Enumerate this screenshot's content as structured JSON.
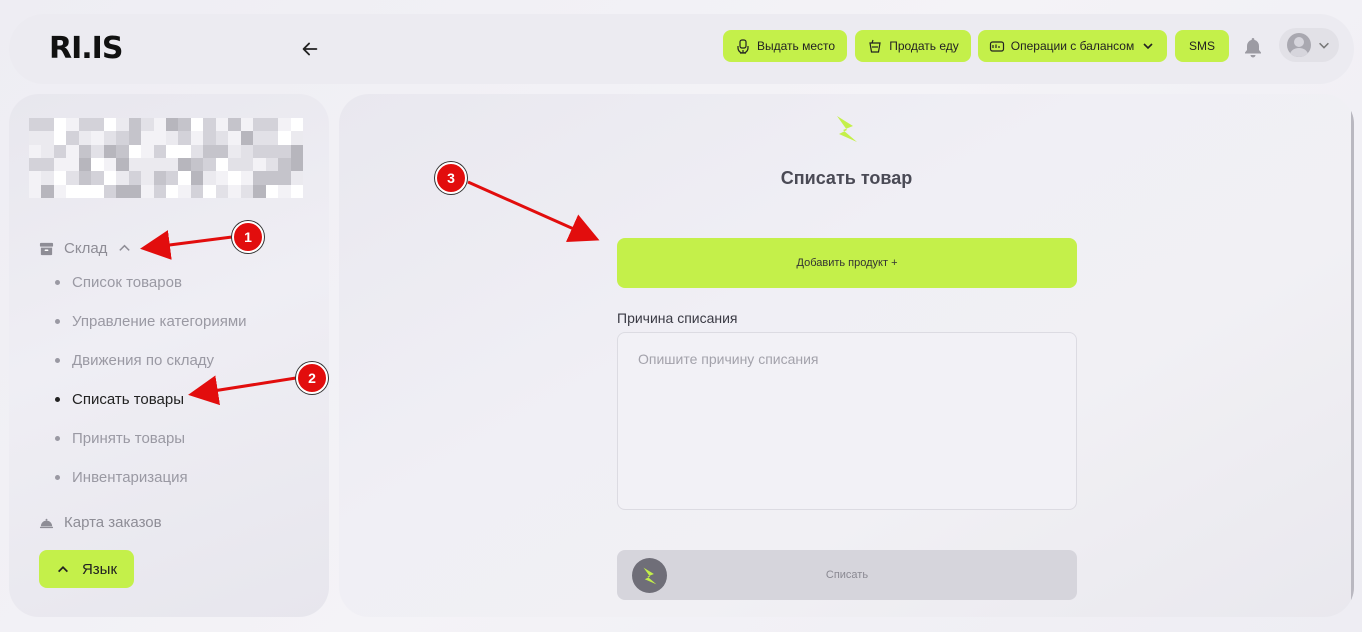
{
  "brand": {
    "logo_text": "RI.IS",
    "accent_color": "#c4f04a",
    "annotation_color": "#e20d0d"
  },
  "header": {
    "back_icon": "arrow-left-icon",
    "buttons": [
      {
        "label": "Выдать место",
        "icon": "chair-icon"
      },
      {
        "label": "Продать еду",
        "icon": "cup-icon"
      },
      {
        "label": "Операции с балансом",
        "icon": "balance-icon"
      },
      {
        "label": "SMS"
      }
    ],
    "bell_icon": "bell-icon",
    "avatar_icon": "user-avatar-icon"
  },
  "sidebar": {
    "section": {
      "label": "Склад",
      "icon": "archive-icon"
    },
    "items": [
      {
        "label": "Список товаров",
        "active": false
      },
      {
        "label": "Управление категориями",
        "active": false
      },
      {
        "label": "Движения по складу",
        "active": false
      },
      {
        "label": "Списать товары",
        "active": true
      },
      {
        "label": "Принять товары",
        "active": false
      },
      {
        "label": "Инвентаризация",
        "active": false
      }
    ],
    "orders_map": {
      "label": "Карта заказов",
      "icon": "food-tray-icon"
    },
    "language_button": {
      "label": "Язык"
    }
  },
  "main": {
    "title": "Списать товар",
    "add_product_button": "Добавить продукт +",
    "reason": {
      "label": "Причина списания",
      "placeholder": "Опишите причину списания",
      "value": ""
    },
    "submit_button": "Списать"
  },
  "annotations": [
    {
      "number": "1"
    },
    {
      "number": "2"
    },
    {
      "number": "3"
    }
  ]
}
